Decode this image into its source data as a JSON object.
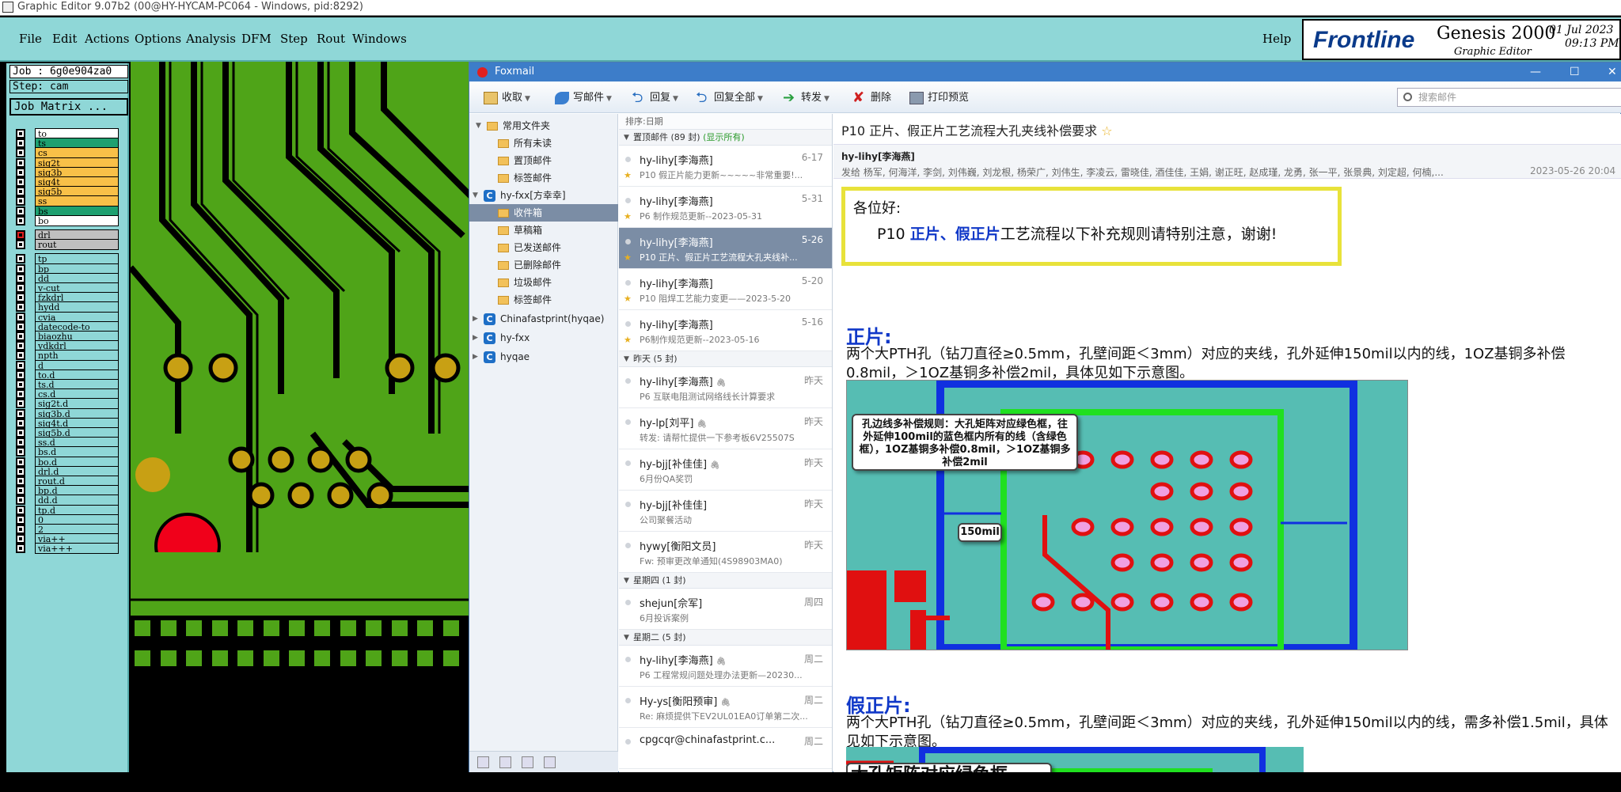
{
  "genesis": {
    "window_title": "Graphic Editor 9.07b2 (00@HY-HYCAM-PC064 - Windows, pid:8292)",
    "menu": [
      "File",
      "Edit",
      "Actions",
      "Options",
      "Analysis",
      "DFM",
      "Step",
      "Rout",
      "Windows"
    ],
    "help_label": "Help",
    "brand": {
      "logo": "Frontline",
      "product": "Genesis 2000",
      "subtitle": "Graphic Editor",
      "date": "01 Jul 2023",
      "time": "09:13 PM"
    },
    "job_label": "Job : 6g0e904za0",
    "step_label": "Step: cam",
    "job_matrix_label": "Job Matrix ...",
    "layers": [
      {
        "name": "to",
        "color": "#ffffff"
      },
      {
        "name": "ts",
        "color": "#1ea070"
      },
      {
        "name": "cs",
        "color": "#f8c048"
      },
      {
        "name": "sig2t",
        "color": "#f8c048"
      },
      {
        "name": "sig3b",
        "color": "#f8c048"
      },
      {
        "name": "sig4t",
        "color": "#f8c048"
      },
      {
        "name": "sig5b",
        "color": "#f8c048"
      },
      {
        "name": "ss",
        "color": "#f8c048"
      },
      {
        "name": "bs",
        "color": "#1ea070"
      },
      {
        "name": "bo",
        "color": "#ffffff"
      },
      {
        "name": "drl",
        "color": "#c0c0c0"
      },
      {
        "name": "rout",
        "color": "#c0c0c0"
      },
      {
        "name": "tp",
        "color": "#8fd7d7"
      },
      {
        "name": "bp",
        "color": "#8fd7d7"
      },
      {
        "name": "dd",
        "color": "#8fd7d7"
      },
      {
        "name": "v-cut",
        "color": "#8fd7d7"
      },
      {
        "name": "fzkdrl",
        "color": "#8fd7d7"
      },
      {
        "name": "hydd",
        "color": "#8fd7d7"
      },
      {
        "name": "cvia",
        "color": "#8fd7d7"
      },
      {
        "name": "datecode-to",
        "color": "#8fd7d7"
      },
      {
        "name": "biaozhu",
        "color": "#8fd7d7"
      },
      {
        "name": "ydkdrl",
        "color": "#8fd7d7"
      },
      {
        "name": "npth",
        "color": "#8fd7d7"
      },
      {
        "name": "d",
        "color": "#8fd7d7"
      },
      {
        "name": "to.d",
        "color": "#8fd7d7"
      },
      {
        "name": "ts.d",
        "color": "#8fd7d7"
      },
      {
        "name": "cs.d",
        "color": "#8fd7d7"
      },
      {
        "name": "sig2t.d",
        "color": "#8fd7d7"
      },
      {
        "name": "sig3b.d",
        "color": "#8fd7d7"
      },
      {
        "name": "sig4t.d",
        "color": "#8fd7d7"
      },
      {
        "name": "sig5b.d",
        "color": "#8fd7d7"
      },
      {
        "name": "ss.d",
        "color": "#8fd7d7"
      },
      {
        "name": "bs.d",
        "color": "#8fd7d7"
      },
      {
        "name": "bo.d",
        "color": "#8fd7d7"
      },
      {
        "name": "drl.d",
        "color": "#8fd7d7"
      },
      {
        "name": "rout.d",
        "color": "#8fd7d7"
      },
      {
        "name": "bp.d",
        "color": "#8fd7d7"
      },
      {
        "name": "dd.d",
        "color": "#8fd7d7"
      },
      {
        "name": "tp.d",
        "color": "#8fd7d7"
      },
      {
        "name": "0",
        "color": "#8fd7d7"
      },
      {
        "name": "2",
        "color": "#8fd7d7"
      },
      {
        "name": "via++",
        "color": "#8fd7d7"
      },
      {
        "name": "via+++",
        "color": "#8fd7d7"
      }
    ]
  },
  "foxmail": {
    "title": "Foxmail",
    "toolbar": {
      "receive": "收取",
      "compose": "写邮件",
      "reply": "回复",
      "reply_all": "回复全部",
      "forward": "转发",
      "delete": "删除",
      "print_preview": "打印预览"
    },
    "search_placeholder": "搜索邮件",
    "folders": [
      {
        "label": "常用文件夹",
        "type": "group"
      },
      {
        "label": "所有未读",
        "type": "folder"
      },
      {
        "label": "置顶邮件",
        "type": "folder"
      },
      {
        "label": "标签邮件",
        "type": "folder"
      },
      {
        "label": "hy-fxx[方幸幸]",
        "type": "account"
      },
      {
        "label": "收件箱",
        "type": "folder",
        "selected": true
      },
      {
        "label": "草稿箱",
        "type": "folder"
      },
      {
        "label": "已发送邮件",
        "type": "folder"
      },
      {
        "label": "已删除邮件",
        "type": "folder"
      },
      {
        "label": "垃圾邮件",
        "type": "folder"
      },
      {
        "label": "标签邮件",
        "type": "folder"
      },
      {
        "label": "Chinafastprint(hyqae)",
        "type": "account"
      },
      {
        "label": "hy-fxx",
        "type": "account"
      },
      {
        "label": "hyqae",
        "type": "account"
      }
    ],
    "sort_label": "排序:日期",
    "groups": {
      "pinned": {
        "label": "置顶邮件 (89 封)",
        "show_all": "(显示所有)"
      },
      "yesterday": {
        "label": "昨天 (5 封)"
      },
      "thursday": {
        "label": "星期四 (1 封)"
      },
      "tuesday": {
        "label": "星期二 (5 封)"
      }
    },
    "mails": [
      {
        "from": "hy-lihy[李海燕]",
        "date": "6-17",
        "subject": "P10 假正片能力更新~~~~~非常重要!..."
      },
      {
        "from": "hy-lihy[李海燕]",
        "date": "5-31",
        "subject": "P6 制作规范更新--2023-05-31"
      },
      {
        "from": "hy-lihy[李海燕]",
        "date": "5-26",
        "subject": "P10 正片、假正片工艺流程大孔夹线补..."
      },
      {
        "from": "hy-lihy[李海燕]",
        "date": "5-20",
        "subject": "P10 阻焊工艺能力变更——2023-5-20"
      },
      {
        "from": "hy-lihy[李海燕]",
        "date": "5-16",
        "subject": "P6制作规范更新--2023-05-16"
      },
      {
        "from": "hy-lihy[李海燕]",
        "date": "昨天",
        "subject": "P6 互联电阻测试网络线长计算要求"
      },
      {
        "from": "hy-lp[刘平]",
        "date": "昨天",
        "subject": "转发: 请帮忙提供一下参考板6V25507S"
      },
      {
        "from": "hy-bjj[补佳佳]",
        "date": "昨天",
        "subject": "6月份QA奖罚"
      },
      {
        "from": "hy-bjj[补佳佳]",
        "date": "昨天",
        "subject": "公司聚餐活动"
      },
      {
        "from": "hywy[衡阳文员]",
        "date": "昨天",
        "subject": "Fw: 预审更改单通知(4S98903MA0)"
      },
      {
        "from": "shejun[佘军]",
        "date": "周四",
        "subject": "6月投诉案例"
      },
      {
        "from": "hy-lihy[李海燕]",
        "date": "周二",
        "subject": "P6 工程常规问题处理办法更新—20230..."
      },
      {
        "from": "Hy-ys[衡阳预审]",
        "date": "周二",
        "subject": "Re: 麻烦提供下EV2UL01EA0订单第二次..."
      },
      {
        "from": "cpgcqr@chinafastprint.c...",
        "date": "周二",
        "subject": ""
      }
    ],
    "reading": {
      "title": "P10 正片、假正片工艺流程大孔夹线补偿要求",
      "from": "hy-lihy[李海燕]",
      "to": "发给 杨军, 何海洋, 李剑, 刘伟巍, 刘龙根, 杨荣广, 刘伟生, 李凌云, 雷晓佳, 酒佳佳, 王娟, 谢正旺, 赵成瑾, 龙勇, 张一平, 张景典, 刘定超, 何楠,...",
      "date": "2023-05-26 20:04",
      "greeting": "各位好:",
      "intro_pre": "P10 ",
      "intro_bold": "正片、假正片",
      "intro_post": "工艺流程以下补充规则请特别注意，谢谢!",
      "sec1_title": "正片:",
      "sec1_text": "两个大PTH孔（钻刀直径≥0.5mm，孔壁间距＜3mm）对应的夹线，孔外延伸150mil以内的线，1OZ基铜多补偿0.8mil，＞1OZ基铜多补偿2mil，具体见如下示意图。",
      "img1_callout": "孔边线多补偿规则：大孔矩阵对应绿色框，往外延伸100mil的蓝色框内所有的线（含绿色框），1OZ基铜多补偿0.8mil，＞1OZ基铜多补偿2mil",
      "img1_label": "150mil",
      "sec2_title": "假正片:",
      "sec2_text": "两个大PTH孔（钻刀直径≥0.5mm，孔壁间距＜3mm）对应的夹线，孔外延伸150mil以内的线，需多补偿1.5mil，具体见如下示意图。",
      "img2_callout": "大孔矩阵对应绿色框，"
    }
  }
}
